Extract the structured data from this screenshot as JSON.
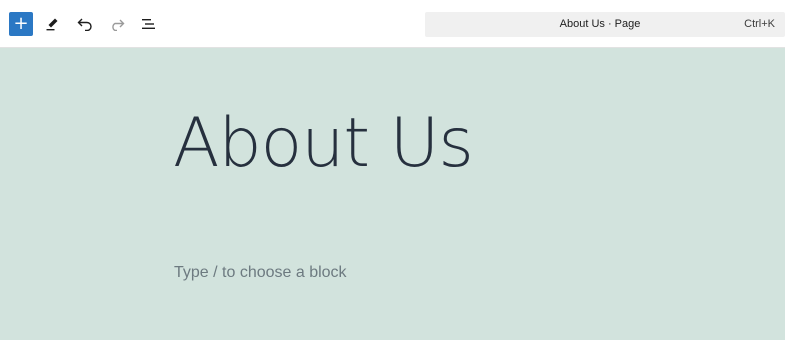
{
  "toolbar": {
    "add_block": {
      "icon": "plus-icon",
      "glyph": "+"
    },
    "tools": {
      "icon": "pencil-icon"
    },
    "undo": {
      "icon": "undo-icon"
    },
    "redo": {
      "icon": "redo-icon"
    },
    "document_overview": {
      "icon": "list-view-icon"
    },
    "command_bar": {
      "title": "About Us · Page",
      "shortcut": "Ctrl+K"
    }
  },
  "canvas": {
    "background": "#d2e3dd",
    "title": "About Us",
    "placeholder": "Type / to choose a block"
  },
  "colors": {
    "accent": "#2b78c4",
    "title_text": "#26303e",
    "placeholder_text": "#6d7a80"
  }
}
